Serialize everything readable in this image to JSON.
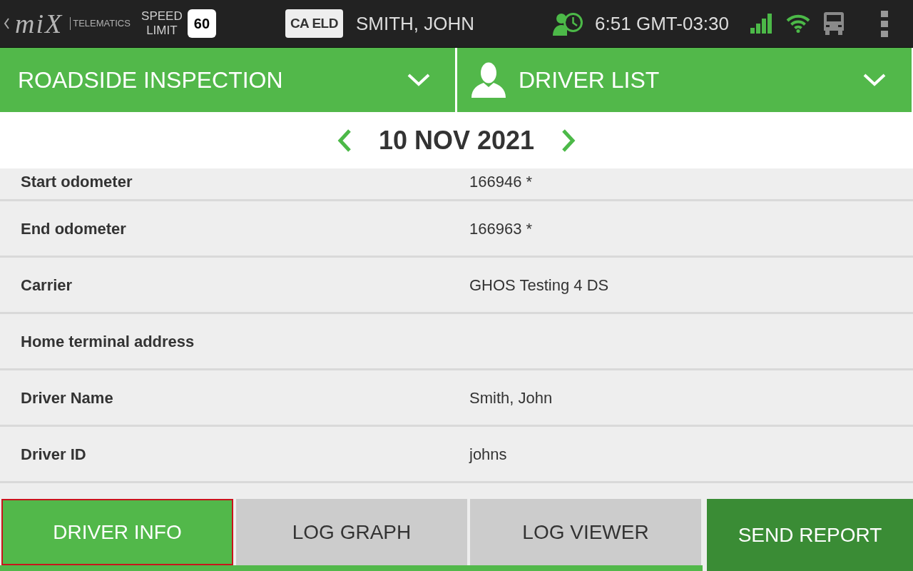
{
  "status_bar": {
    "logo": {
      "wordmark": "miX",
      "tagline": "TELEMATICS"
    },
    "speed_limit": {
      "label": "SPEED LIMIT",
      "value": "60"
    },
    "eld_badge": "CA ELD",
    "driver": "SMITH, JOHN",
    "time": "6:51 GMT-03:30"
  },
  "header": {
    "dropdowns": [
      {
        "label": "ROADSIDE INSPECTION",
        "kind": "plain"
      },
      {
        "label": "DRIVER LIST",
        "kind": "person"
      }
    ]
  },
  "date_nav": {
    "date": "10 NOV 2021"
  },
  "details": [
    {
      "label": "Start odometer",
      "value": "166946 *"
    },
    {
      "label": "End odometer",
      "value": "166963 *"
    },
    {
      "label": "Carrier",
      "value": "GHOS Testing 4 DS"
    },
    {
      "label": "Home terminal address"
    },
    {
      "label": "Driver Name",
      "value": "Smith, John"
    },
    {
      "label": "Driver ID",
      "value": "johns"
    }
  ],
  "tabs": [
    {
      "label": "DRIVER INFO",
      "selected": true
    },
    {
      "label": "LOG GRAPH",
      "selected": false
    },
    {
      "label": "LOG VIEWER",
      "selected": false
    }
  ],
  "send_button": {
    "label": "SEND REPORT"
  }
}
